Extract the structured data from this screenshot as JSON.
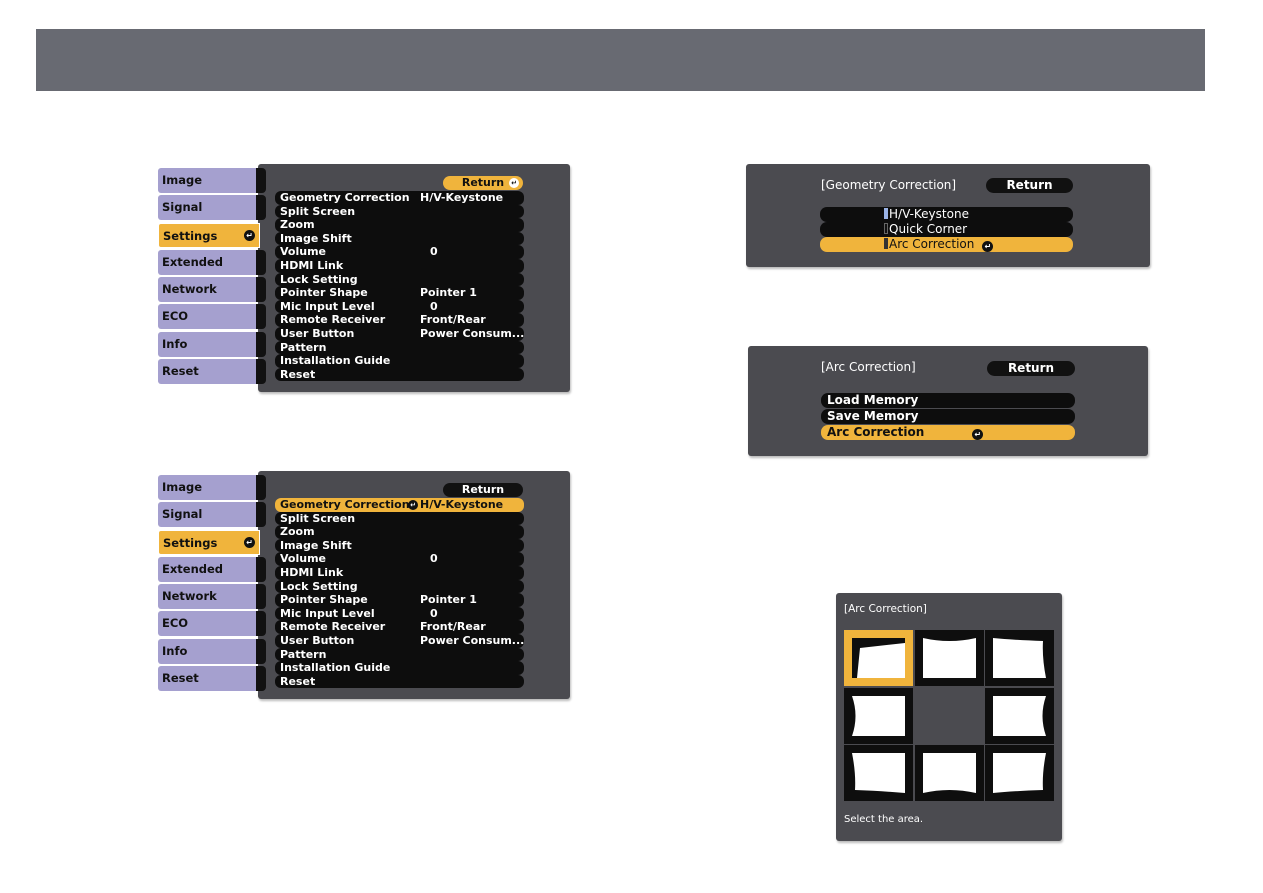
{
  "colors": {
    "header_bar": "#686a72",
    "panel_bg": "#4b4b50",
    "tab_bg": "#a5a0cf",
    "highlight": "#f0b43c",
    "item_bg": "#0d0d0d",
    "radio_selected": "#9ab3e6"
  },
  "settings_menu_1": {
    "return_label": "Return",
    "return_highlighted": true,
    "tabs": [
      {
        "label": "Image"
      },
      {
        "label": "Signal"
      },
      {
        "label": "Settings",
        "active": true
      },
      {
        "label": "Extended"
      },
      {
        "label": "Network"
      },
      {
        "label": "ECO"
      },
      {
        "label": "Info"
      },
      {
        "label": "Reset"
      }
    ],
    "items": [
      {
        "label": "Geometry Correction",
        "value": "H/V-Keystone"
      },
      {
        "label": "Split Screen",
        "value": ""
      },
      {
        "label": "Zoom",
        "value": ""
      },
      {
        "label": "Image Shift",
        "value": ""
      },
      {
        "label": "Volume",
        "value": "0"
      },
      {
        "label": "HDMI Link",
        "value": ""
      },
      {
        "label": "Lock Setting",
        "value": ""
      },
      {
        "label": "Pointer Shape",
        "value": "Pointer 1"
      },
      {
        "label": "Mic Input Level",
        "value": "0"
      },
      {
        "label": "Remote Receiver",
        "value": "Front/Rear"
      },
      {
        "label": "User Button",
        "value": "Power Consum..."
      },
      {
        "label": "Pattern",
        "value": ""
      },
      {
        "label": "Installation Guide",
        "value": ""
      },
      {
        "label": "Reset",
        "value": ""
      }
    ]
  },
  "settings_menu_2": {
    "return_label": "Return",
    "return_highlighted": false,
    "highlighted_item": "Geometry Correction",
    "tabs": [
      {
        "label": "Image"
      },
      {
        "label": "Signal"
      },
      {
        "label": "Settings",
        "active": true
      },
      {
        "label": "Extended"
      },
      {
        "label": "Network"
      },
      {
        "label": "ECO"
      },
      {
        "label": "Info"
      },
      {
        "label": "Reset"
      }
    ],
    "items": [
      {
        "label": "Geometry Correction",
        "value": "H/V-Keystone"
      },
      {
        "label": "Split Screen",
        "value": ""
      },
      {
        "label": "Zoom",
        "value": ""
      },
      {
        "label": "Image Shift",
        "value": ""
      },
      {
        "label": "Volume",
        "value": "0"
      },
      {
        "label": "HDMI Link",
        "value": ""
      },
      {
        "label": "Lock Setting",
        "value": ""
      },
      {
        "label": "Pointer Shape",
        "value": "Pointer 1"
      },
      {
        "label": "Mic Input Level",
        "value": "0"
      },
      {
        "label": "Remote Receiver",
        "value": "Front/Rear"
      },
      {
        "label": "User Button",
        "value": "Power Consum..."
      },
      {
        "label": "Pattern",
        "value": ""
      },
      {
        "label": "Installation Guide",
        "value": ""
      },
      {
        "label": "Reset",
        "value": ""
      }
    ]
  },
  "geometry_dialog": {
    "title": "[Geometry Correction]",
    "return_label": "Return",
    "options": [
      {
        "label": "H/V-Keystone",
        "selected": true
      },
      {
        "label": "Quick Corner",
        "selected": false
      },
      {
        "label": "Arc Correction",
        "selected": false,
        "highlighted": true
      }
    ]
  },
  "arc_dialog": {
    "title": "[Arc Correction]",
    "return_label": "Return",
    "options": [
      {
        "label": "Load Memory"
      },
      {
        "label": "Save Memory"
      },
      {
        "label": "Arc Correction",
        "highlighted": true
      }
    ]
  },
  "arc_area_dialog": {
    "title": "[Arc Correction]",
    "hint": "Select the area.",
    "areas": [
      {
        "name": "top-left",
        "selected": true
      },
      {
        "name": "top-center",
        "selected": false
      },
      {
        "name": "top-right",
        "selected": false
      },
      {
        "name": "middle-left",
        "selected": false
      },
      {
        "name": "center",
        "selected": false,
        "empty": true
      },
      {
        "name": "middle-right",
        "selected": false
      },
      {
        "name": "bottom-left",
        "selected": false
      },
      {
        "name": "bottom-center",
        "selected": false
      },
      {
        "name": "bottom-right",
        "selected": false
      }
    ]
  },
  "icons": {
    "enter": "↵"
  }
}
